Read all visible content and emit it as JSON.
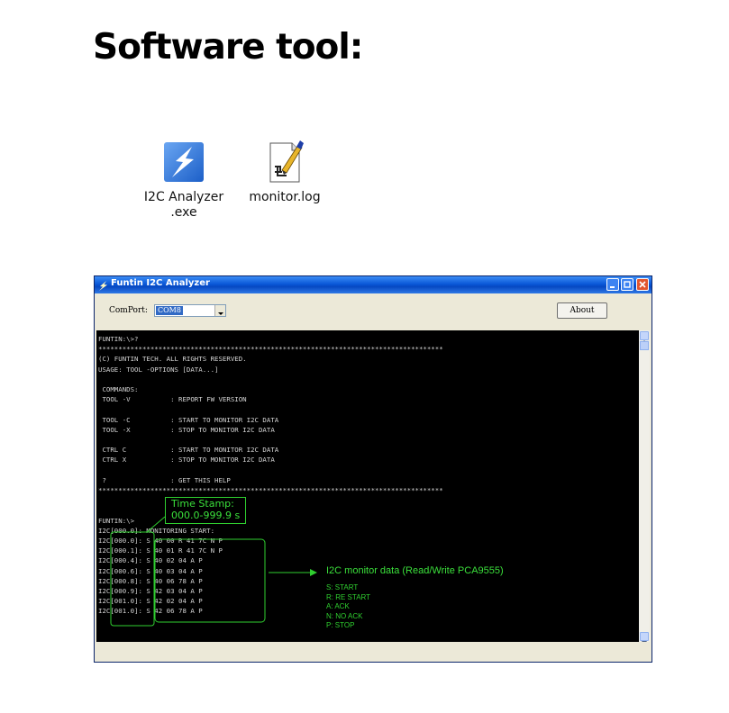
{
  "slide": {
    "title": "Software tool:"
  },
  "desktop_icons": [
    {
      "name": "I2C Analyzer",
      "name_line2": ".exe",
      "icon": "lightning-app-icon"
    },
    {
      "name": "monitor.log",
      "icon": "log-file-icon"
    }
  ],
  "window": {
    "title": "Funtin I2C Analyzer",
    "comport_label": "ComPort:",
    "comport_value": "COM8",
    "about_label": "About"
  },
  "console": {
    "lines": [
      "FUNTIN:\\>?",
      "**************************************************************************************",
      "(C) FUNTIN TECH. ALL RIGHTS RESERVED.",
      "USAGE: TOOL -OPTIONS [DATA...]",
      "",
      " COMMANDS:",
      " TOOL -V          : REPORT FW VERSION",
      "",
      " TOOL -C          : START TO MONITOR I2C DATA",
      " TOOL -X          : STOP TO MONITOR I2C DATA",
      "",
      " CTRL C           : START TO MONITOR I2C DATA",
      " CTRL X           : STOP TO MONITOR I2C DATA",
      "",
      " ?                : GET THIS HELP",
      "**************************************************************************************",
      "",
      "",
      "FUNTIN:\\>",
      "I2C[000.0]: MONITORING START:",
      "I2C[000.0]: S 40 00 R 41 7C N P",
      "I2C[000.1]: S 40 01 R 41 7C N P",
      "I2C[000.4]: S 40 02 04 A P",
      "I2C[000.6]: S 40 03 04 A P",
      "I2C[000.8]: S 40 06 78 A P",
      "I2C[000.9]: S 42 03 04 A P",
      "I2C[001.0]: S 42 02 04 A P",
      "I2C[001.0]: S 42 06 78 A P"
    ]
  },
  "annotations": {
    "timestamp_title": "Time Stamp:",
    "timestamp_range": "000.0-999.9 s",
    "monitor_label": "I2C monitor data (Read/Write PCA9555)",
    "legend": [
      "S: START",
      "R: RE START",
      "A: ACK",
      "N: NO ACK",
      "P: STOP"
    ]
  },
  "colors": {
    "annotation": "#32d232",
    "titlebar": "#0a58d8",
    "console_bg": "#000000"
  }
}
